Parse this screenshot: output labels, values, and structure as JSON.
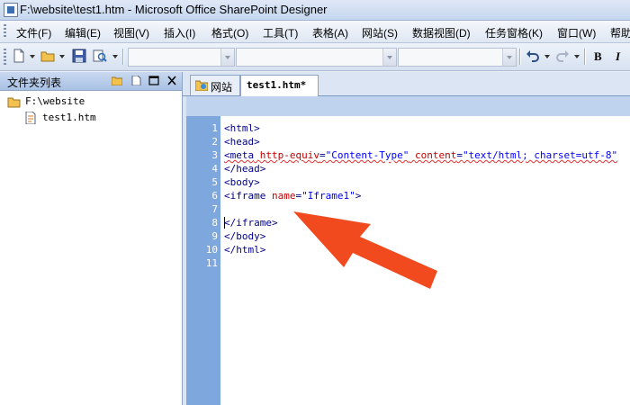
{
  "window": {
    "title": "F:\\website\\test1.htm - Microsoft Office SharePoint Designer"
  },
  "menu": {
    "items": [
      "文件(F)",
      "编辑(E)",
      "视图(V)",
      "插入(I)",
      "格式(O)",
      "工具(T)",
      "表格(A)",
      "网站(S)",
      "数据视图(D)",
      "任务窗格(K)",
      "窗口(W)",
      "帮助"
    ]
  },
  "toolbar": {
    "bold_label": "B",
    "italic_label": "I"
  },
  "folder_list": {
    "title": "文件夹列表",
    "root": "F:\\website",
    "file": "test1.htm"
  },
  "tabs": [
    {
      "label": "网站"
    },
    {
      "label": "test1.htm*"
    }
  ],
  "editor": {
    "line_numbers": [
      "1",
      "2",
      "3",
      "4",
      "5",
      "6",
      "7",
      "8",
      "9",
      "10",
      "11"
    ],
    "lines": {
      "l1": "<html>",
      "l2": "<head>",
      "l3_tag": "<meta",
      "l3_a1": "http-equiv",
      "l3_v1": "\"Content-Type\"",
      "l3_a2": "content",
      "l3_v2": "\"text/html; charset=utf-8\"",
      "l4": "</head>",
      "l5": "<body>",
      "l6_tag": "<iframe",
      "l6_attr": "name",
      "l6_val": "\"Iframe1\"",
      "l6_end": ">",
      "l8": "</iframe>",
      "l9": "</body>",
      "l10": "</html>"
    }
  },
  "colors": {
    "gutter": "#7ea7dd",
    "arrow": "#f04a1e"
  }
}
